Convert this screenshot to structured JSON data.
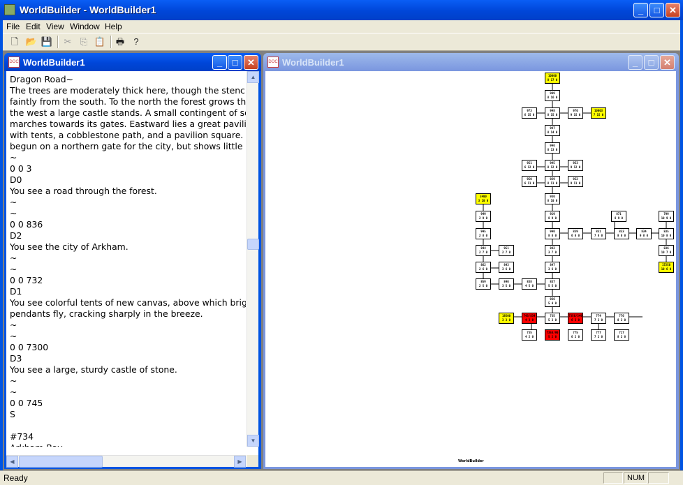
{
  "app": {
    "title": "WorldBuilder - WorldBuilder1",
    "menu": [
      "File",
      "Edit",
      "View",
      "Window",
      "Help"
    ],
    "toolbar_icons": [
      "new-file-icon",
      "open-folder-icon",
      "save-icon",
      "cut-icon",
      "copy-icon",
      "paste-icon",
      "print-icon",
      "help-icon"
    ]
  },
  "text_window": {
    "title": "WorldBuilder1",
    "lines": [
      "Dragon Road~",
      "The trees are moderately thick here, though the stench of the city is",
      "faintly from the south. To the north the forest grows thicker, while",
      "the west a large castle stands. A small contingent of soldiers",
      "marches towards its gates. Eastward lies a great pavilion,",
      "with tents, a cobblestone path, and a pavilion square. Work has",
      "begun on a northern gate for the city, but shows little",
      "~",
      "0 0 3",
      "D0",
      "You see a road through the forest.",
      "~",
      "~",
      "0 0 836",
      "D2",
      "You see the city of Arkham.",
      "~",
      "~",
      "0 0 732",
      "D1",
      "You see colorful tents of new canvas, above which bright",
      "pendants fly, cracking sharply in the breeze.",
      "~",
      "~",
      "0 0 7300",
      "D3",
      "You see a large, sturdy castle of stone.",
      "~",
      "~",
      "0 0 745",
      "S",
      "",
      "#734",
      "Arkham Bay~"
    ]
  },
  "map_window": {
    "title": "WorldBuilder1",
    "footer": "WorldBuilder",
    "rooms": [
      {
        "id": "10000",
        "sub": "8 17 0",
        "c": "y"
      },
      {
        "id": "949",
        "sub": "8 16 0",
        "c": ""
      },
      {
        "id": "973",
        "sub": "6 15 0",
        "c": ""
      },
      {
        "id": "948",
        "sub": "8 15 0",
        "c": ""
      },
      {
        "id": "970",
        "sub": "9 15 0",
        "c": ""
      },
      {
        "id": "10003",
        "sub": "7 15 0",
        "c": "y"
      },
      {
        "id": "947",
        "sub": "8 14 0",
        "c": ""
      },
      {
        "id": "946",
        "sub": "8 13 0",
        "c": ""
      },
      {
        "id": "951",
        "sub": "6 12 0",
        "c": ""
      },
      {
        "id": "945",
        "sub": "8 12 0",
        "c": ""
      },
      {
        "id": "953",
        "sub": "9 12 0",
        "c": ""
      },
      {
        "id": "950",
        "sub": "6 11 0",
        "c": ""
      },
      {
        "id": "929",
        "sub": "8 11 0",
        "c": ""
      },
      {
        "id": "952",
        "sub": "9 11 0",
        "c": ""
      },
      {
        "id": "930",
        "sub": "8 10 0",
        "c": ""
      },
      {
        "id": "3400",
        "sub": "3 10 0",
        "c": "y"
      },
      {
        "id": "919",
        "sub": "8 9 0",
        "c": ""
      },
      {
        "id": "949",
        "sub": "2 9 0",
        "c": ""
      },
      {
        "id": "871",
        "sub": "8 9 0",
        "c": ""
      },
      {
        "id": "799",
        "sub": "10 9 0",
        "c": ""
      },
      {
        "id": "940",
        "sub": "8 8 0",
        "c": ""
      },
      {
        "id": "839",
        "sub": "6 8 0",
        "c": ""
      },
      {
        "id": "831",
        "sub": "7 8 0",
        "c": ""
      },
      {
        "id": "833",
        "sub": "8 8 0",
        "c": ""
      },
      {
        "id": "834",
        "sub": "9 8 0",
        "c": ""
      },
      {
        "id": "835",
        "sub": "10 8 0",
        "c": ""
      },
      {
        "id": "945",
        "sub": "2 8 0",
        "c": ""
      },
      {
        "id": "844",
        "sub": "2 7 0",
        "c": ""
      },
      {
        "id": "951",
        "sub": "2 7 0",
        "c": ""
      },
      {
        "id": "842",
        "sub": "3 7 0",
        "c": ""
      },
      {
        "id": "836",
        "sub": "10 7 0",
        "c": ""
      },
      {
        "id": "17258",
        "sub": "10 6 0",
        "c": "y"
      },
      {
        "id": "862",
        "sub": "2 6 0",
        "c": ""
      },
      {
        "id": "843",
        "sub": "3 6 0",
        "c": ""
      },
      {
        "id": "847",
        "sub": "3 6 0",
        "c": ""
      },
      {
        "id": "859",
        "sub": "2 5 0",
        "c": ""
      },
      {
        "id": "840",
        "sub": "3 5 0",
        "c": ""
      },
      {
        "id": "838",
        "sub": "4 5 0",
        "c": ""
      },
      {
        "id": "837",
        "sub": "5 5 0",
        "c": ""
      },
      {
        "id": "936",
        "sub": "5 4 0",
        "c": ""
      },
      {
        "id": "18500",
        "sub": "3 3 0",
        "c": "y"
      },
      {
        "id": "743/834",
        "sub": "4 3 0",
        "c": "r"
      },
      {
        "id": "735",
        "sub": "5 3 0",
        "c": ""
      },
      {
        "id": "7356/349",
        "sub": "6 3 0",
        "c": "r"
      },
      {
        "id": "774",
        "sub": "7 3 0",
        "c": ""
      },
      {
        "id": "776",
        "sub": "8 3 0",
        "c": ""
      },
      {
        "id": "735",
        "sub": "4 2 0",
        "c": ""
      },
      {
        "id": "7356/90",
        "sub": "5 2 0",
        "c": "r"
      },
      {
        "id": "775",
        "sub": "6 2 0",
        "c": ""
      },
      {
        "id": "777",
        "sub": "7 2 0",
        "c": ""
      },
      {
        "id": "717",
        "sub": "8 2 0",
        "c": ""
      }
    ]
  }
}
